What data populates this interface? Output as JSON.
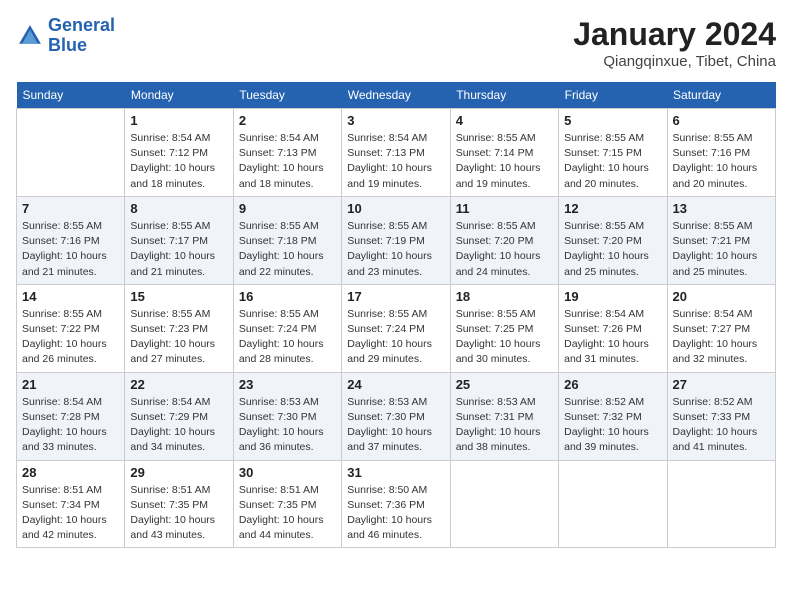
{
  "header": {
    "logo_line1": "General",
    "logo_line2": "Blue",
    "month_title": "January 2024",
    "location": "Qiangqinxue, Tibet, China"
  },
  "weekdays": [
    "Sunday",
    "Monday",
    "Tuesday",
    "Wednesday",
    "Thursday",
    "Friday",
    "Saturday"
  ],
  "weeks": [
    [
      {
        "day": "",
        "sunrise": "",
        "sunset": "",
        "daylight": ""
      },
      {
        "day": "1",
        "sunrise": "Sunrise: 8:54 AM",
        "sunset": "Sunset: 7:12 PM",
        "daylight": "Daylight: 10 hours and 18 minutes."
      },
      {
        "day": "2",
        "sunrise": "Sunrise: 8:54 AM",
        "sunset": "Sunset: 7:13 PM",
        "daylight": "Daylight: 10 hours and 18 minutes."
      },
      {
        "day": "3",
        "sunrise": "Sunrise: 8:54 AM",
        "sunset": "Sunset: 7:13 PM",
        "daylight": "Daylight: 10 hours and 19 minutes."
      },
      {
        "day": "4",
        "sunrise": "Sunrise: 8:55 AM",
        "sunset": "Sunset: 7:14 PM",
        "daylight": "Daylight: 10 hours and 19 minutes."
      },
      {
        "day": "5",
        "sunrise": "Sunrise: 8:55 AM",
        "sunset": "Sunset: 7:15 PM",
        "daylight": "Daylight: 10 hours and 20 minutes."
      },
      {
        "day": "6",
        "sunrise": "Sunrise: 8:55 AM",
        "sunset": "Sunset: 7:16 PM",
        "daylight": "Daylight: 10 hours and 20 minutes."
      }
    ],
    [
      {
        "day": "7",
        "sunrise": "Sunrise: 8:55 AM",
        "sunset": "Sunset: 7:16 PM",
        "daylight": "Daylight: 10 hours and 21 minutes."
      },
      {
        "day": "8",
        "sunrise": "Sunrise: 8:55 AM",
        "sunset": "Sunset: 7:17 PM",
        "daylight": "Daylight: 10 hours and 21 minutes."
      },
      {
        "day": "9",
        "sunrise": "Sunrise: 8:55 AM",
        "sunset": "Sunset: 7:18 PM",
        "daylight": "Daylight: 10 hours and 22 minutes."
      },
      {
        "day": "10",
        "sunrise": "Sunrise: 8:55 AM",
        "sunset": "Sunset: 7:19 PM",
        "daylight": "Daylight: 10 hours and 23 minutes."
      },
      {
        "day": "11",
        "sunrise": "Sunrise: 8:55 AM",
        "sunset": "Sunset: 7:20 PM",
        "daylight": "Daylight: 10 hours and 24 minutes."
      },
      {
        "day": "12",
        "sunrise": "Sunrise: 8:55 AM",
        "sunset": "Sunset: 7:20 PM",
        "daylight": "Daylight: 10 hours and 25 minutes."
      },
      {
        "day": "13",
        "sunrise": "Sunrise: 8:55 AM",
        "sunset": "Sunset: 7:21 PM",
        "daylight": "Daylight: 10 hours and 25 minutes."
      }
    ],
    [
      {
        "day": "14",
        "sunrise": "Sunrise: 8:55 AM",
        "sunset": "Sunset: 7:22 PM",
        "daylight": "Daylight: 10 hours and 26 minutes."
      },
      {
        "day": "15",
        "sunrise": "Sunrise: 8:55 AM",
        "sunset": "Sunset: 7:23 PM",
        "daylight": "Daylight: 10 hours and 27 minutes."
      },
      {
        "day": "16",
        "sunrise": "Sunrise: 8:55 AM",
        "sunset": "Sunset: 7:24 PM",
        "daylight": "Daylight: 10 hours and 28 minutes."
      },
      {
        "day": "17",
        "sunrise": "Sunrise: 8:55 AM",
        "sunset": "Sunset: 7:24 PM",
        "daylight": "Daylight: 10 hours and 29 minutes."
      },
      {
        "day": "18",
        "sunrise": "Sunrise: 8:55 AM",
        "sunset": "Sunset: 7:25 PM",
        "daylight": "Daylight: 10 hours and 30 minutes."
      },
      {
        "day": "19",
        "sunrise": "Sunrise: 8:54 AM",
        "sunset": "Sunset: 7:26 PM",
        "daylight": "Daylight: 10 hours and 31 minutes."
      },
      {
        "day": "20",
        "sunrise": "Sunrise: 8:54 AM",
        "sunset": "Sunset: 7:27 PM",
        "daylight": "Daylight: 10 hours and 32 minutes."
      }
    ],
    [
      {
        "day": "21",
        "sunrise": "Sunrise: 8:54 AM",
        "sunset": "Sunset: 7:28 PM",
        "daylight": "Daylight: 10 hours and 33 minutes."
      },
      {
        "day": "22",
        "sunrise": "Sunrise: 8:54 AM",
        "sunset": "Sunset: 7:29 PM",
        "daylight": "Daylight: 10 hours and 34 minutes."
      },
      {
        "day": "23",
        "sunrise": "Sunrise: 8:53 AM",
        "sunset": "Sunset: 7:30 PM",
        "daylight": "Daylight: 10 hours and 36 minutes."
      },
      {
        "day": "24",
        "sunrise": "Sunrise: 8:53 AM",
        "sunset": "Sunset: 7:30 PM",
        "daylight": "Daylight: 10 hours and 37 minutes."
      },
      {
        "day": "25",
        "sunrise": "Sunrise: 8:53 AM",
        "sunset": "Sunset: 7:31 PM",
        "daylight": "Daylight: 10 hours and 38 minutes."
      },
      {
        "day": "26",
        "sunrise": "Sunrise: 8:52 AM",
        "sunset": "Sunset: 7:32 PM",
        "daylight": "Daylight: 10 hours and 39 minutes."
      },
      {
        "day": "27",
        "sunrise": "Sunrise: 8:52 AM",
        "sunset": "Sunset: 7:33 PM",
        "daylight": "Daylight: 10 hours and 41 minutes."
      }
    ],
    [
      {
        "day": "28",
        "sunrise": "Sunrise: 8:51 AM",
        "sunset": "Sunset: 7:34 PM",
        "daylight": "Daylight: 10 hours and 42 minutes."
      },
      {
        "day": "29",
        "sunrise": "Sunrise: 8:51 AM",
        "sunset": "Sunset: 7:35 PM",
        "daylight": "Daylight: 10 hours and 43 minutes."
      },
      {
        "day": "30",
        "sunrise": "Sunrise: 8:51 AM",
        "sunset": "Sunset: 7:35 PM",
        "daylight": "Daylight: 10 hours and 44 minutes."
      },
      {
        "day": "31",
        "sunrise": "Sunrise: 8:50 AM",
        "sunset": "Sunset: 7:36 PM",
        "daylight": "Daylight: 10 hours and 46 minutes."
      },
      {
        "day": "",
        "sunrise": "",
        "sunset": "",
        "daylight": ""
      },
      {
        "day": "",
        "sunrise": "",
        "sunset": "",
        "daylight": ""
      },
      {
        "day": "",
        "sunrise": "",
        "sunset": "",
        "daylight": ""
      }
    ]
  ]
}
